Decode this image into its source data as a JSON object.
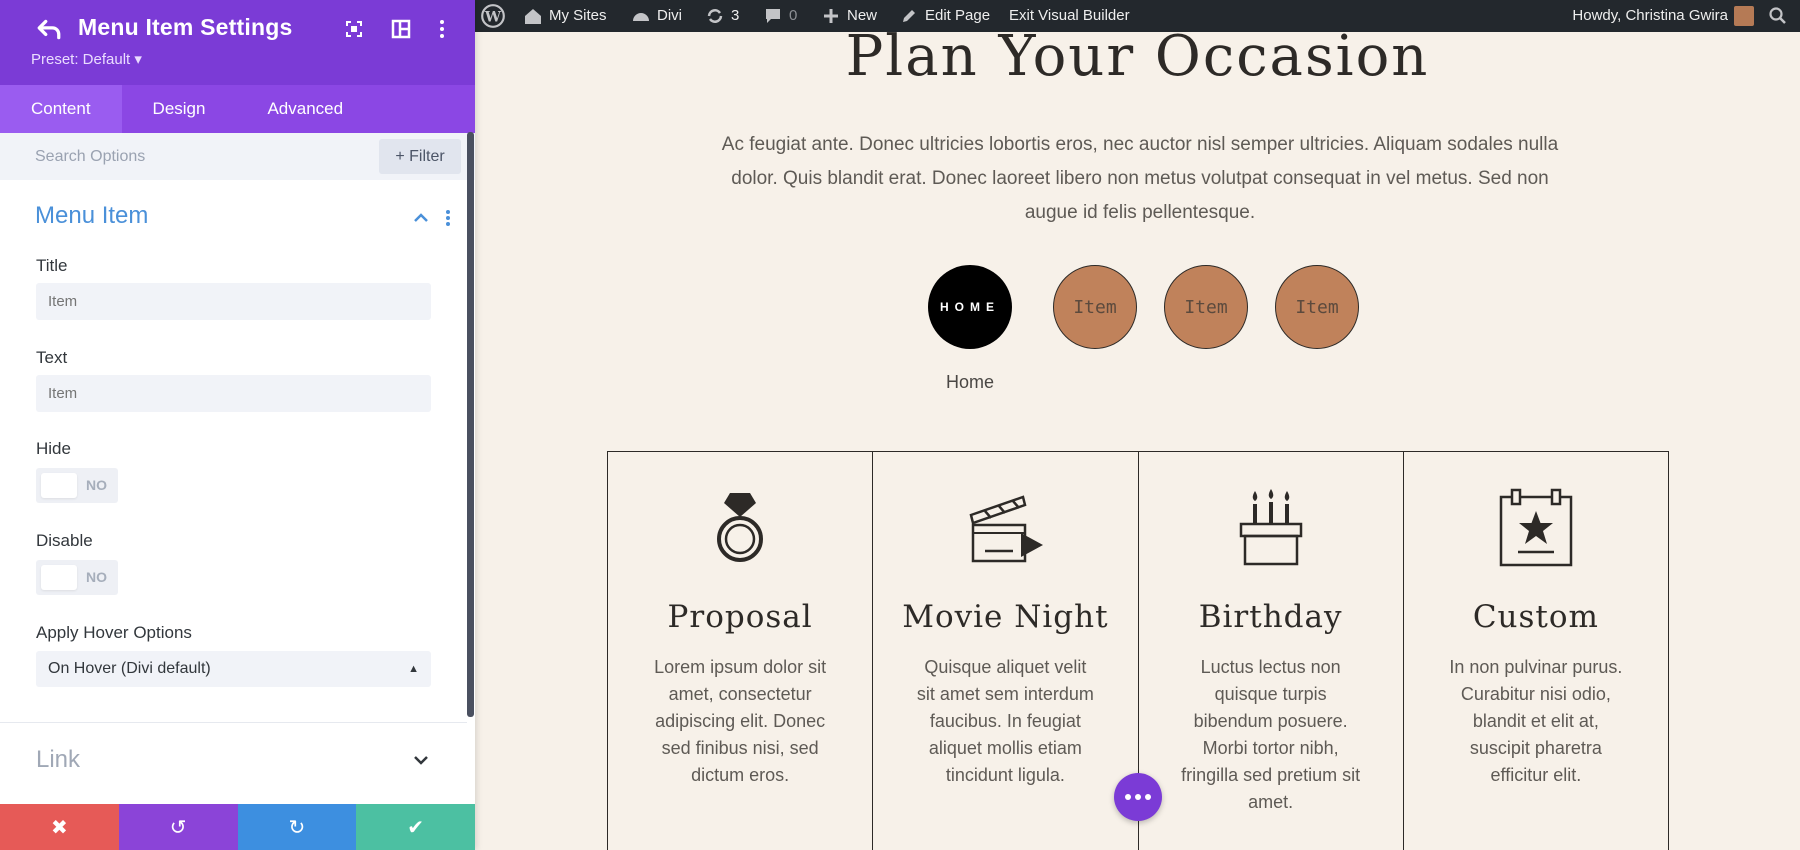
{
  "panel": {
    "title": "Menu Item Settings",
    "preset": "Preset: Default ▾",
    "tabs": [
      {
        "label": "Content",
        "active": true
      },
      {
        "label": "Design",
        "active": false
      },
      {
        "label": "Advanced",
        "active": false
      }
    ],
    "search_placeholder": "Search Options",
    "filter_label": "+ Filter",
    "section_title": "Menu Item",
    "fields": {
      "title_label": "Title",
      "title_placeholder": "Item",
      "text_label": "Text",
      "text_placeholder": "Item",
      "hide_label": "Hide",
      "hide_value": "NO",
      "disable_label": "Disable",
      "disable_value": "NO",
      "hover_label": "Apply Hover Options",
      "hover_value": "On Hover (Divi default)"
    },
    "link_section": "Link",
    "actions": [
      {
        "icon": "close-icon",
        "glyph": "✖",
        "color": "#e65a57"
      },
      {
        "icon": "undo-icon",
        "glyph": "↺",
        "color": "#8b44d8"
      },
      {
        "icon": "redo-icon",
        "glyph": "↻",
        "color": "#3d8fe0"
      },
      {
        "icon": "check-icon",
        "glyph": "✔",
        "color": "#4cc0a2"
      }
    ]
  },
  "adminbar": {
    "my_sites": "My Sites",
    "divi": "Divi",
    "updates_count": "3",
    "comments_count": "0",
    "new": "New",
    "edit_page": "Edit Page",
    "exit_builder": "Exit Visual Builder",
    "howdy": "Howdy, Christina Gwira"
  },
  "page": {
    "heading": "Plan Your Occasion",
    "intro": "Ac feugiat ante. Donec ultricies lobortis eros, nec auctor nisl semper ultricies. Aliquam sodales nulla dolor. Quis blandit erat. Donec laoreet libero non metus volutpat consequat in vel metus. Sed non augue id felis pellentesque.",
    "menu": {
      "home": "HOME",
      "items": [
        "Item",
        "Item",
        "Item"
      ],
      "home_caption": "Home"
    },
    "cards": [
      {
        "icon": "ring-icon",
        "title": "Proposal",
        "text": "Lorem ipsum dolor sit amet, consectetur adipiscing elit. Donec sed finibus nisi, sed dictum eros."
      },
      {
        "icon": "clapperboard-icon",
        "title": "Movie Night",
        "text": "Quisque aliquet velit sit amet sem interdum faucibus. In feugiat aliquet mollis etiam tincidunt ligula."
      },
      {
        "icon": "birthday-cake-icon",
        "title": "Birthday",
        "text": "Luctus lectus non quisque turpis bibendum posuere. Morbi tortor nibh, fringilla sed pretium sit amet."
      },
      {
        "icon": "calendar-star-icon",
        "title": "Custom",
        "text": "In non pulvinar purus. Curabitur nisi odio, blandit et elit at, suscipit pharetra efficitur elit."
      }
    ]
  },
  "colors": {
    "divi_purple": "#7b3bd6",
    "tab_purple": "#8b47e4",
    "accent_blue": "#4a90d9",
    "page_bg": "#f7f1e9",
    "menu_item_fill": "#c0825b"
  }
}
